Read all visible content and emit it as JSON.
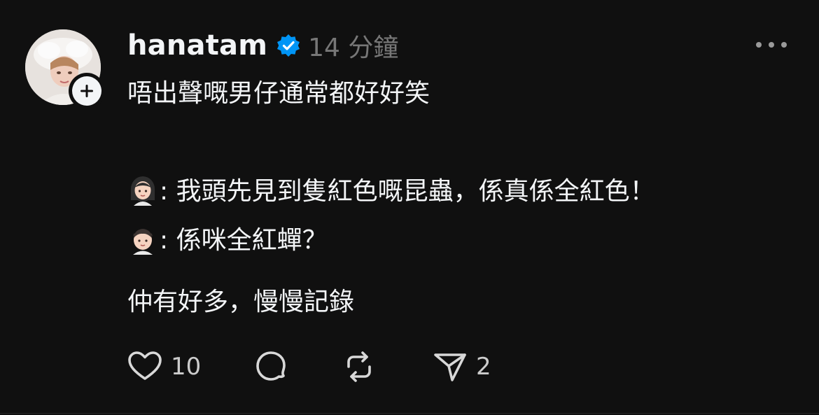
{
  "post": {
    "username": "hanatam",
    "verified": true,
    "timestamp": "14 分鐘",
    "lines": [
      "唔出聲嘅男仔通常都好好笑",
      ": 我頭先見到隻紅色嘅昆蟲，係真係全紅色！",
      ": 係咪全紅蟬？",
      "仲有好多，慢慢記錄"
    ]
  },
  "actions": {
    "like_count": "10",
    "reply_count": "",
    "repost_count": "",
    "share_count": "2"
  },
  "colors": {
    "background": "#101010",
    "text": "#f3f5f7",
    "secondary_text": "#777777",
    "verified_blue": "#0095f6"
  },
  "icons": [
    "avatar",
    "plus-icon",
    "verified-badge-icon",
    "more-icon",
    "woman-emoji-icon",
    "man-emoji-icon",
    "heart-icon",
    "comment-icon",
    "repost-icon",
    "share-icon"
  ]
}
